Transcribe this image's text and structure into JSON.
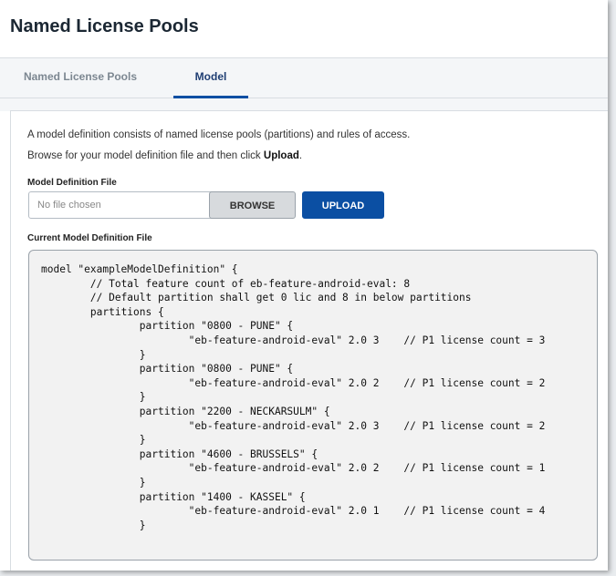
{
  "header": {
    "title": "Named License Pools"
  },
  "tabs": [
    {
      "label": "Named License Pools",
      "active": false
    },
    {
      "label": "Model",
      "active": true
    }
  ],
  "intro": {
    "line1": "A model definition consists of named license pools (partitions) and rules of access.",
    "line2_prefix": "Browse for your model definition file and then click ",
    "line2_bold": "Upload",
    "line2_suffix": "."
  },
  "model_file": {
    "label": "Model Definition File",
    "value": "No file chosen",
    "browse_label": "BROWSE",
    "upload_label": "UPLOAD"
  },
  "current": {
    "label": "Current Model Definition File",
    "content": "model \"exampleModelDefinition\" {\n\t// Total feature count of eb-feature-android-eval: 8\n\t// Default partition shall get 0 lic and 8 in below partitions\n\tpartitions {\n\t\tpartition \"0800 - PUNE\" {\n\t\t\t\"eb-feature-android-eval\" 2.0 3    // P1 license count = 3\n\t\t}\n\t\tpartition \"0800 - PUNE\" {\n\t\t\t\"eb-feature-android-eval\" 2.0 2    // P1 license count = 2\n\t\t}\n\t\tpartition \"2200 - NECKARSULM\" {\n\t\t\t\"eb-feature-android-eval\" 2.0 3    // P1 license count = 2\n\t\t}\n\t\tpartition \"4600 - BRUSSELS\" {\n\t\t\t\"eb-feature-android-eval\" 2.0 2    // P1 license count = 1\n\t\t}\n\t\tpartition \"1400 - KASSEL\" {\n\t\t\t\"eb-feature-android-eval\" 2.0 1    // P1 license count = 4\n\t\t}"
  },
  "colors": {
    "accent": "#0b4fa3",
    "active_tab_text": "#1f3e73",
    "inactive_tab_text": "#7c8791",
    "code_background": "#f2f2f2"
  }
}
